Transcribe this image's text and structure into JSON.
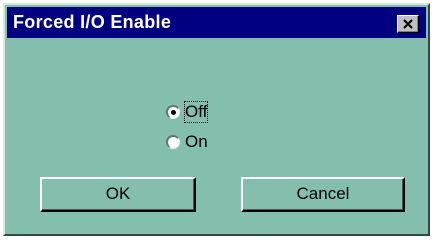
{
  "window": {
    "title": "Forced I/O Enable",
    "close_icon": "close-icon",
    "colors": {
      "title_bar": "#000080",
      "dialog_bg": "#84bfad"
    }
  },
  "options": [
    {
      "label": "Off",
      "selected": true
    },
    {
      "label": "On",
      "selected": false
    }
  ],
  "buttons": {
    "ok_label": "OK",
    "cancel_label": "Cancel"
  }
}
